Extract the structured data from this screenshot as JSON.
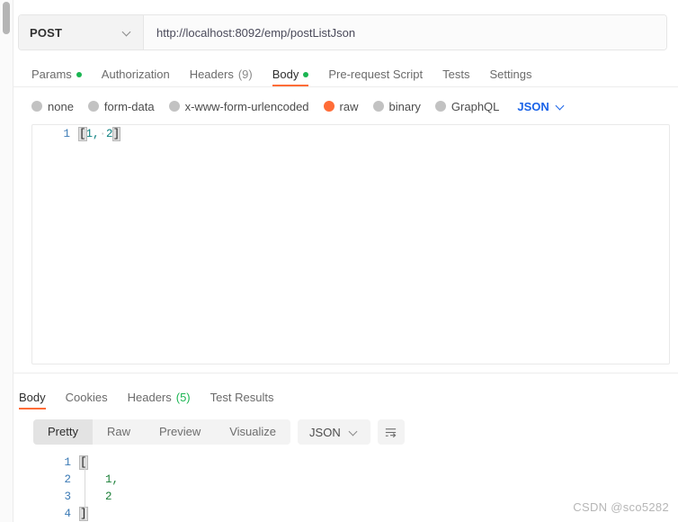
{
  "request": {
    "method": "POST",
    "url": "http://localhost:8092/emp/postListJson",
    "tabs": [
      {
        "label": "Params",
        "dot": true,
        "count": "",
        "active": false
      },
      {
        "label": "Authorization",
        "dot": false,
        "count": "",
        "active": false
      },
      {
        "label": "Headers",
        "dot": false,
        "count": "(9)",
        "active": false
      },
      {
        "label": "Body",
        "dot": true,
        "count": "",
        "active": true
      },
      {
        "label": "Pre-request Script",
        "dot": false,
        "count": "",
        "active": false
      },
      {
        "label": "Tests",
        "dot": false,
        "count": "",
        "active": false
      },
      {
        "label": "Settings",
        "dot": false,
        "count": "",
        "active": false
      }
    ],
    "body_types": [
      {
        "label": "none",
        "selected": false
      },
      {
        "label": "form-data",
        "selected": false
      },
      {
        "label": "x-www-form-urlencoded",
        "selected": false
      },
      {
        "label": "raw",
        "selected": true
      },
      {
        "label": "binary",
        "selected": false
      },
      {
        "label": "GraphQL",
        "selected": false
      }
    ],
    "raw_format": "JSON",
    "editor": {
      "line_numbers": [
        "1"
      ],
      "open_bracket": "[",
      "value_first": "1,",
      "space_dot": "·",
      "value_second": "2",
      "close_bracket": "]"
    }
  },
  "response": {
    "tabs": [
      {
        "label": "Body",
        "count": "",
        "active": true
      },
      {
        "label": "Cookies",
        "count": "",
        "active": false
      },
      {
        "label": "Headers",
        "count": "(5)",
        "active": false
      },
      {
        "label": "Test Results",
        "count": "",
        "active": false
      }
    ],
    "view_modes": [
      {
        "label": "Pretty",
        "active": true
      },
      {
        "label": "Raw",
        "active": false
      },
      {
        "label": "Preview",
        "active": false
      },
      {
        "label": "Visualize",
        "active": false
      }
    ],
    "format": "JSON",
    "wrap_icon": "word-wrap-icon",
    "body_lines": [
      {
        "num": "1",
        "text": "[",
        "bracket": true
      },
      {
        "num": "2",
        "text": "1,",
        "bracket": false
      },
      {
        "num": "3",
        "text": "2",
        "bracket": false
      },
      {
        "num": "4",
        "text": "]",
        "bracket": true
      }
    ]
  },
  "watermark": "CSDN @sco5282",
  "colors": {
    "accent_orange": "#ff6c37",
    "link_blue": "#1a63e8",
    "status_green": "#1bb552",
    "gutter_blue": "#3b7ab5",
    "json_green": "#1a7f37"
  }
}
